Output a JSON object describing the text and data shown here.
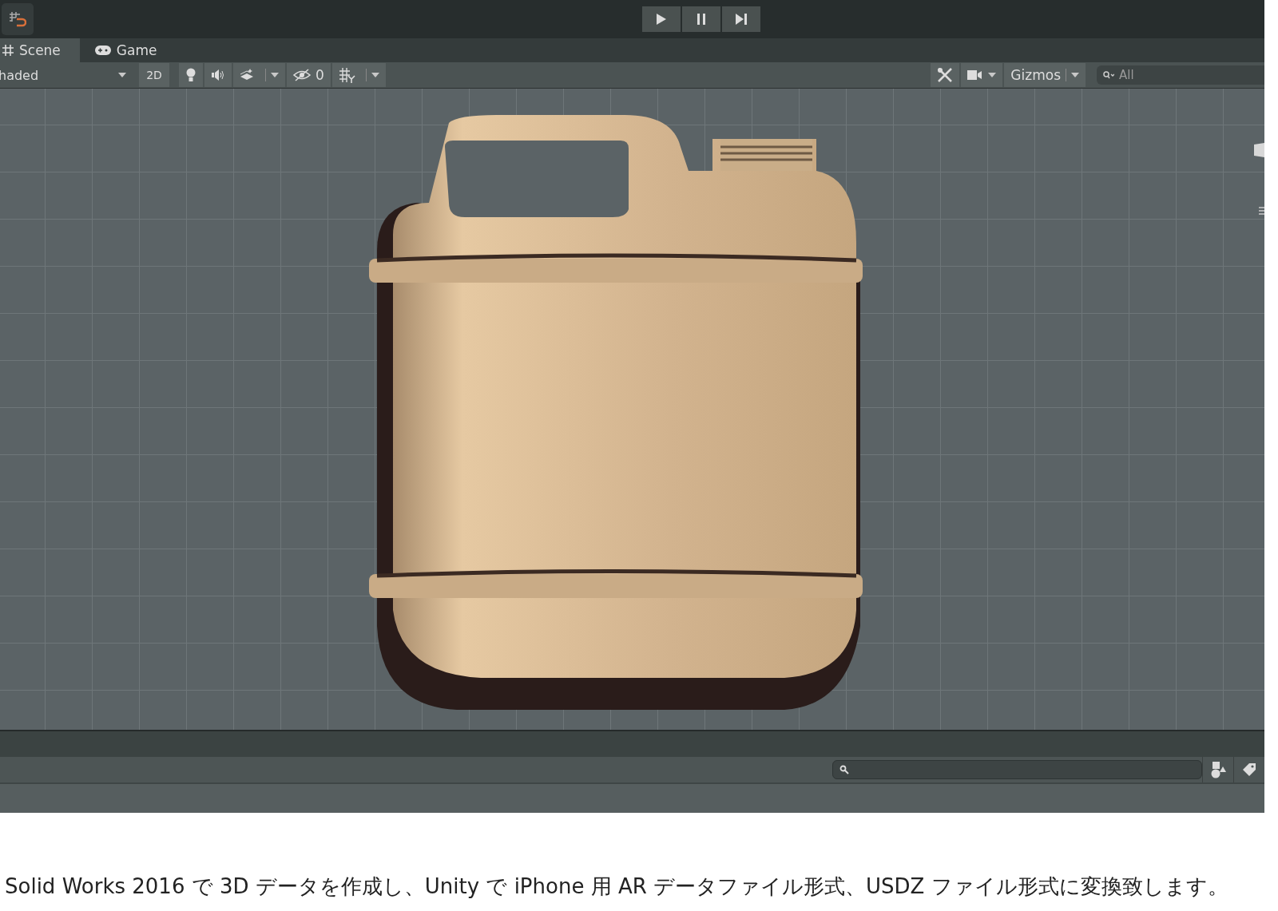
{
  "tabs": [
    {
      "label": "Scene",
      "kind": "scene",
      "selected": true
    },
    {
      "label": "Game",
      "kind": "game",
      "selected": false
    }
  ],
  "toolbar": {
    "shading_mode": "haded",
    "mode_2d": "2D",
    "hidden_count": "0",
    "gizmos": "Gizmos",
    "search": {
      "placeholder": "All"
    }
  },
  "caption": "Solid Works 2016 で 3D データを作成し、Unity で iPhone 用 AR データファイル形式、USDZ ファイル形式に変換致します。"
}
